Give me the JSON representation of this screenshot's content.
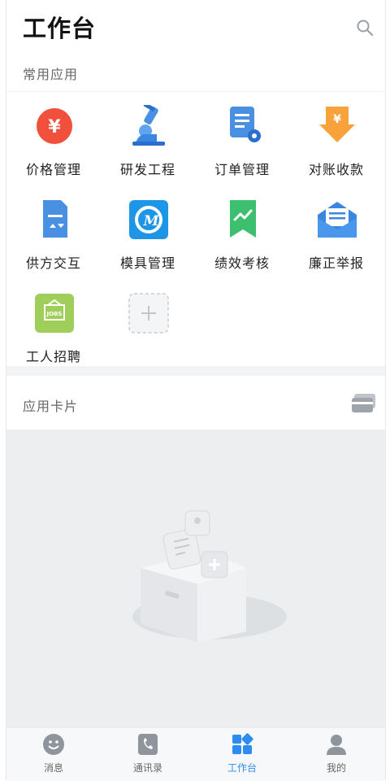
{
  "header": {
    "title": "工作台"
  },
  "common_apps": {
    "label": "常用应用",
    "items": [
      {
        "label": "价格管理",
        "icon": "yen-circle-icon"
      },
      {
        "label": "研发工程",
        "icon": "microscope-icon"
      },
      {
        "label": "订单管理",
        "icon": "order-doc-icon"
      },
      {
        "label": "对账收款",
        "icon": "yen-download-icon"
      },
      {
        "label": "供方交互",
        "icon": "supplier-doc-icon"
      },
      {
        "label": "模具管理",
        "icon": "mold-logo-icon"
      },
      {
        "label": "绩效考核",
        "icon": "performance-flag-icon"
      },
      {
        "label": "廉正举报",
        "icon": "mail-envelope-icon"
      },
      {
        "label": "工人招聘",
        "icon": "jobs-board-icon"
      }
    ]
  },
  "app_cards": {
    "label": "应用卡片"
  },
  "tabbar": {
    "items": [
      {
        "label": "消息",
        "icon": "smile-chat-icon"
      },
      {
        "label": "通讯录",
        "icon": "phone-book-icon"
      },
      {
        "label": "工作台",
        "icon": "workbench-grid-icon"
      },
      {
        "label": "我的",
        "icon": "person-icon"
      }
    ],
    "active": "工作台"
  },
  "colors": {
    "accent": "#2d8cf0",
    "red": "#f0503c",
    "orange": "#f7a23b",
    "green": "#3cbf6e",
    "lime": "#9fce5a"
  }
}
